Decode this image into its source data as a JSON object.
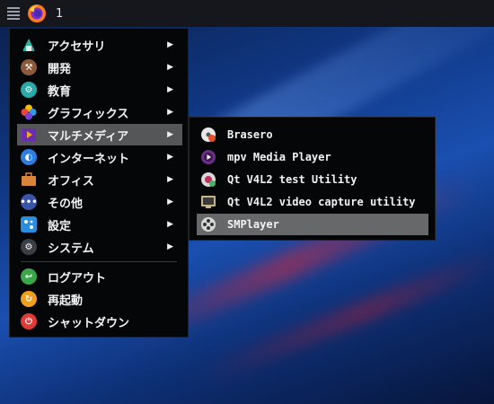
{
  "panel": {
    "workspace_number": "1",
    "browser_icon": "firefox-icon",
    "menu_icon": "app-menu-icon"
  },
  "main_menu": {
    "items": [
      {
        "label": "アクセサリ",
        "icon": "accessories-icon",
        "has_submenu": true
      },
      {
        "label": "開発",
        "icon": "development-icon",
        "has_submenu": true
      },
      {
        "label": "教育",
        "icon": "education-icon",
        "has_submenu": true
      },
      {
        "label": "グラフィックス",
        "icon": "graphics-icon",
        "has_submenu": true
      },
      {
        "label": "マルチメディア",
        "icon": "multimedia-icon",
        "has_submenu": true,
        "active": true
      },
      {
        "label": "インターネット",
        "icon": "internet-icon",
        "has_submenu": true
      },
      {
        "label": "オフィス",
        "icon": "office-icon",
        "has_submenu": true
      },
      {
        "label": "その他",
        "icon": "other-icon",
        "has_submenu": true
      },
      {
        "label": "設定",
        "icon": "settings-icon",
        "has_submenu": true
      },
      {
        "label": "システム",
        "icon": "system-icon",
        "has_submenu": true
      }
    ],
    "session_items": [
      {
        "label": "ログアウト",
        "icon": "logout-icon"
      },
      {
        "label": "再起動",
        "icon": "reboot-icon"
      },
      {
        "label": "シャットダウン",
        "icon": "shutdown-icon"
      }
    ],
    "arrow_glyph": "▶"
  },
  "sub_menu": {
    "items": [
      {
        "label": "Brasero",
        "icon": "brasero-icon"
      },
      {
        "label": "mpv Media Player",
        "icon": "mpv-icon"
      },
      {
        "label": "Qt V4L2 test Utility",
        "icon": "qv4l2-icon"
      },
      {
        "label": "Qt V4L2 video capture utility",
        "icon": "qvidcap-icon"
      },
      {
        "label": "SMPlayer",
        "icon": "smplayer-icon",
        "active": true
      }
    ]
  },
  "colors": {
    "highlight_main": "#545658",
    "highlight_sub": "#666869",
    "menu_bg": "#050608",
    "panel_bg": "#15171c"
  }
}
